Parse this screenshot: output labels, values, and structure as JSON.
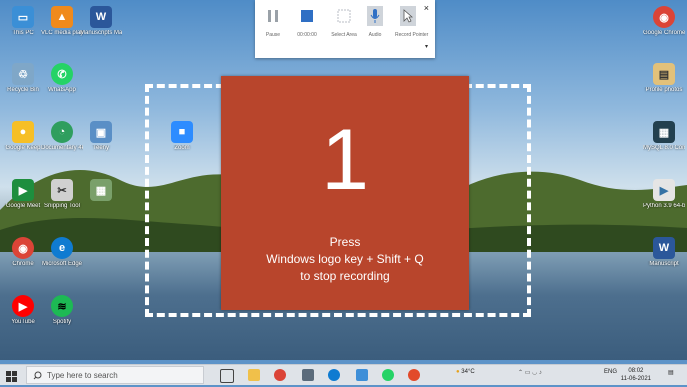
{
  "desktop_icons_left": [
    {
      "label": "This PC",
      "color": "#3b8fd6",
      "glyph": "▭"
    },
    {
      "label": "VLC media player",
      "color": "#f08a1c",
      "glyph": "▲"
    },
    {
      "label": "Manuscripts Marketing",
      "color": "#2b579a",
      "glyph": "W"
    },
    {
      "label": "Recycle Bin",
      "color": "#7fa7c8",
      "glyph": "♲"
    },
    {
      "label": "WhatsApp",
      "color": "#25d366",
      "glyph": "✆"
    },
    {
      "label": "Google Keep",
      "color": "#f6bf26",
      "glyph": "●"
    },
    {
      "label": "Documentary 4k Ravi (30)",
      "color": "#2f9e5e",
      "glyph": "◔"
    },
    {
      "label": "Teeny",
      "color": "#5a8fc6",
      "glyph": "▣"
    },
    {
      "label": "Google Meet",
      "color": "#1e8e3e",
      "glyph": "▶"
    },
    {
      "label": "Snipping Tool",
      "color": "#d0d0d0",
      "glyph": "✂"
    },
    {
      "label": "Chrome",
      "color": "#db4437",
      "glyph": "◉"
    },
    {
      "label": "Microsoft Edge",
      "color": "#0f7bd1",
      "glyph": "e"
    },
    {
      "label": "YouTube",
      "color": "#ff0000",
      "glyph": "▶"
    },
    {
      "label": "Spotify",
      "color": "#1db954",
      "glyph": "≋"
    },
    {
      "label": "Zoom",
      "color": "#2d8cff",
      "glyph": "■"
    }
  ],
  "desktop_icons_right": [
    {
      "label": "Google Chrome",
      "color": "#db4437",
      "glyph": "◉"
    },
    {
      "label": "Profile photos",
      "color": "#e2c17a",
      "glyph": "▤"
    },
    {
      "label": "MySQL 8.0 Command...",
      "color": "#23404f",
      "glyph": "▦"
    },
    {
      "label": "Python 3.9 64-bit",
      "color": "#e5e5e5",
      "glyph": "▶"
    },
    {
      "label": "Manuscript",
      "color": "#2b579a",
      "glyph": "W"
    }
  ],
  "recorder": {
    "pause_label": "Pause",
    "timer_label": "00:00:00",
    "select_label": "Select Area",
    "audio_label": "Audio",
    "pointer_label": "Record Pointer",
    "close_label": "×",
    "expand_label": "▾"
  },
  "countdown": {
    "number": "1",
    "line1": "Press",
    "line2": "Windows logo key + Shift + Q",
    "line3": "to stop recording"
  },
  "taskbar": {
    "search_placeholder": "Type here to search",
    "weather": "34°C",
    "language": "ENG",
    "time": "08:02",
    "date": "11-06-2021"
  },
  "colors": {
    "countdown_bg": "#b8452c",
    "taskbar_bg": "#dfe3e8"
  }
}
